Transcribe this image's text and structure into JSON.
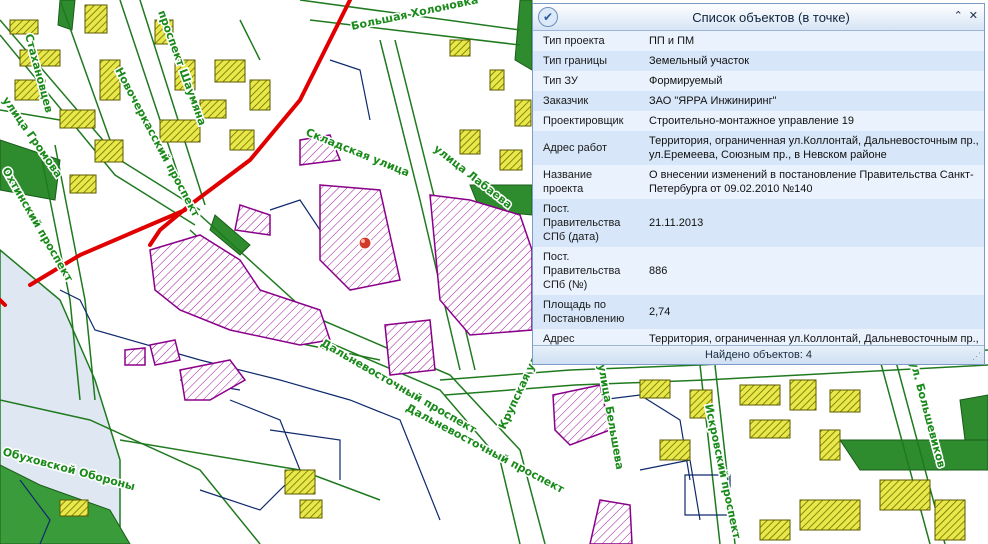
{
  "map": {
    "streets": [
      "Большая Холоновка",
      "проспект Шаумяна",
      "Новочеркасский проспект",
      "Стахановцев",
      "улица Громова",
      "Охтинский проспект",
      "Складская улица",
      "улица Лабаева",
      "Дальневосточный проспект",
      "Крупская улица",
      "Дальневосточный проспект",
      "Обуховской Обороны",
      "улица Бельшева",
      "Искровский проспект",
      "ул. Большевиков"
    ],
    "colors": {
      "building_fill": "#c8c800",
      "plot_outline": "#8b008b",
      "green_area": "#2e8b2e",
      "road_red": "#e10000",
      "water": "#dfe8f2",
      "road_edge": "#1f7a1f"
    }
  },
  "panel": {
    "title": "Список объектов (в точке)",
    "logo_icon": "check-circle-icon",
    "collapse_icon": "double-chevron-up-icon",
    "close_icon": "close-icon",
    "rows": [
      {
        "key": "Тип проекта",
        "value": "ПП и ПМ"
      },
      {
        "key": "Тип границы",
        "value": "Земельный участок"
      },
      {
        "key": "Тип ЗУ",
        "value": "Формируемый"
      },
      {
        "key": "Заказчик",
        "value": "ЗАО \"ЯРРА Инжиниринг\""
      },
      {
        "key": "Проектировщик",
        "value": "Строительно-монтажное управление 19"
      },
      {
        "key": "Адрес работ",
        "value": "Территория, ограниченная ул.Коллонтай, Дальневосточным пр., ул.Еремеева, Союзным пр., в Невском районе"
      },
      {
        "key": "Название проекта",
        "value": "О внесении изменений в постановление Правительства Санкт-Петербурга от 09.02.2010 №140"
      },
      {
        "key": "Пост. Правительства СПб (дата)",
        "value": "21.11.2013"
      },
      {
        "key": "Пост. Правительства СПб (№)",
        "value": "886"
      },
      {
        "key": "Площадь по Постановлению",
        "value": "2,74"
      },
      {
        "key": "Адрес проектирования",
        "value": "Территория, ограниченная ул.Коллонтай, Дальневосточным пр., ул.Еремеева, Союзным пр., в Невском районе"
      }
    ],
    "footer": "Найдено объектов: 4"
  }
}
